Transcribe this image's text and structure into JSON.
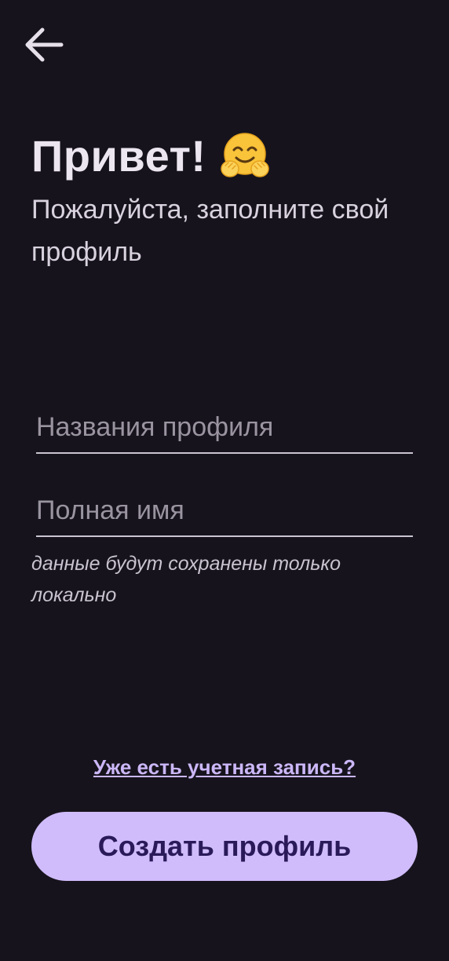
{
  "header": {
    "back_icon": "arrow-left-icon"
  },
  "greeting": {
    "title": "Привет!",
    "emoji_icon": "hugging-face-emoji",
    "subtitle": "Пожалуйста, заполните свой профиль"
  },
  "form": {
    "profile_name": {
      "value": "",
      "placeholder": "Названия профиля"
    },
    "full_name": {
      "value": "",
      "placeholder": "Полная имя"
    },
    "hint": "данные будут сохранены только локально"
  },
  "actions": {
    "login_link": "Уже есть учетная запись?",
    "create_button": "Создать профиль"
  },
  "colors": {
    "background": "#16131c",
    "accent": "#d0bcfb",
    "button_text": "#2a1a5a",
    "link": "#cbb7f7"
  }
}
